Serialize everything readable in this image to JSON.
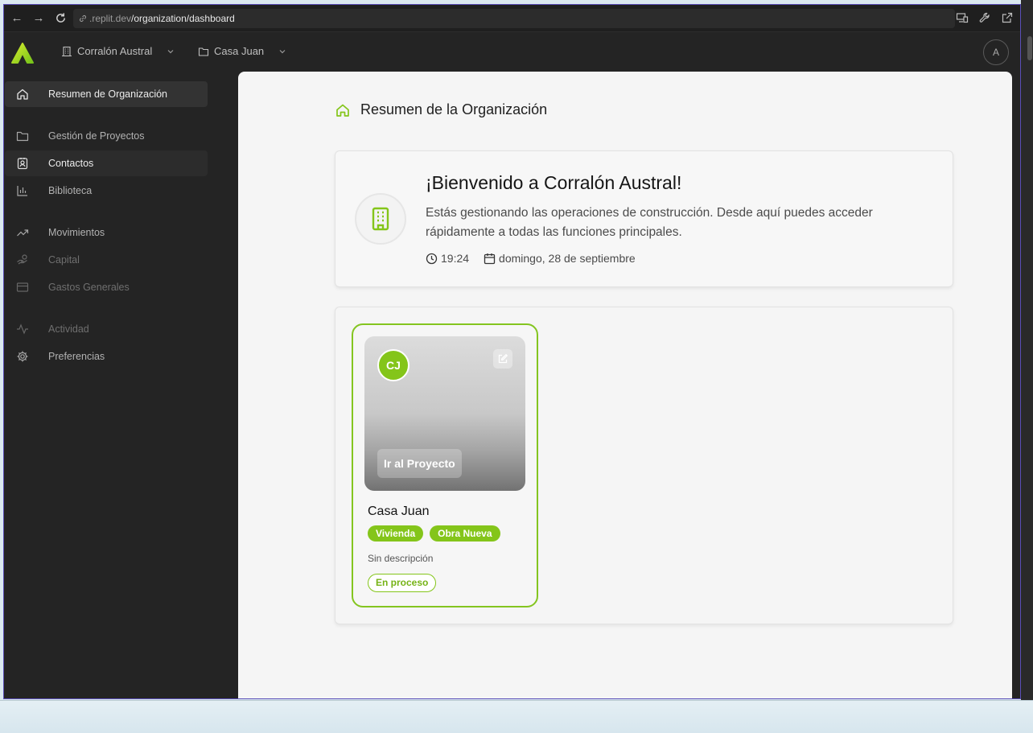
{
  "browser": {
    "url_domain": ".replit.dev",
    "url_path": "/organization/dashboard"
  },
  "header": {
    "organization": "Corralón Austral",
    "project": "Casa Juan",
    "avatar_initial": "A"
  },
  "sidebar": {
    "items": [
      {
        "label": "Resumen de Organización",
        "icon": "home-icon",
        "state": "active"
      },
      {
        "label": "Gestión de Proyectos",
        "icon": "folder-icon",
        "state": "normal"
      },
      {
        "label": "Contactos",
        "icon": "contact-icon",
        "state": "hover"
      },
      {
        "label": "Biblioteca",
        "icon": "chart-icon",
        "state": "normal"
      },
      {
        "label": "Movimientos",
        "icon": "trend-icon",
        "state": "normal"
      },
      {
        "label": "Capital",
        "icon": "hand-coin-icon",
        "state": "disabled"
      },
      {
        "label": "Gastos Generales",
        "icon": "card-icon",
        "state": "disabled"
      },
      {
        "label": "Actividad",
        "icon": "activity-icon",
        "state": "disabled"
      },
      {
        "label": "Preferencias",
        "icon": "gear-icon",
        "state": "normal"
      }
    ]
  },
  "main": {
    "page_title": "Resumen de la Organización",
    "welcome": {
      "title": "¡Bienvenido a Corralón Austral!",
      "description": "Estás gestionando las operaciones de construcción. Desde aquí puedes acceder rápidamente a todas las funciones principales.",
      "time": "19:24",
      "date": "domingo, 28 de septiembre"
    },
    "projects": [
      {
        "initials": "CJ",
        "go_label": "Ir al Proyecto",
        "name": "Casa Juan",
        "tags": [
          "Vivienda",
          "Obra Nueva"
        ],
        "description": "Sin descripción",
        "status": "En proceso"
      }
    ]
  },
  "colors": {
    "accent": "#84c51a",
    "sidebar_bg": "#242424",
    "main_bg": "#f5f5f5"
  }
}
